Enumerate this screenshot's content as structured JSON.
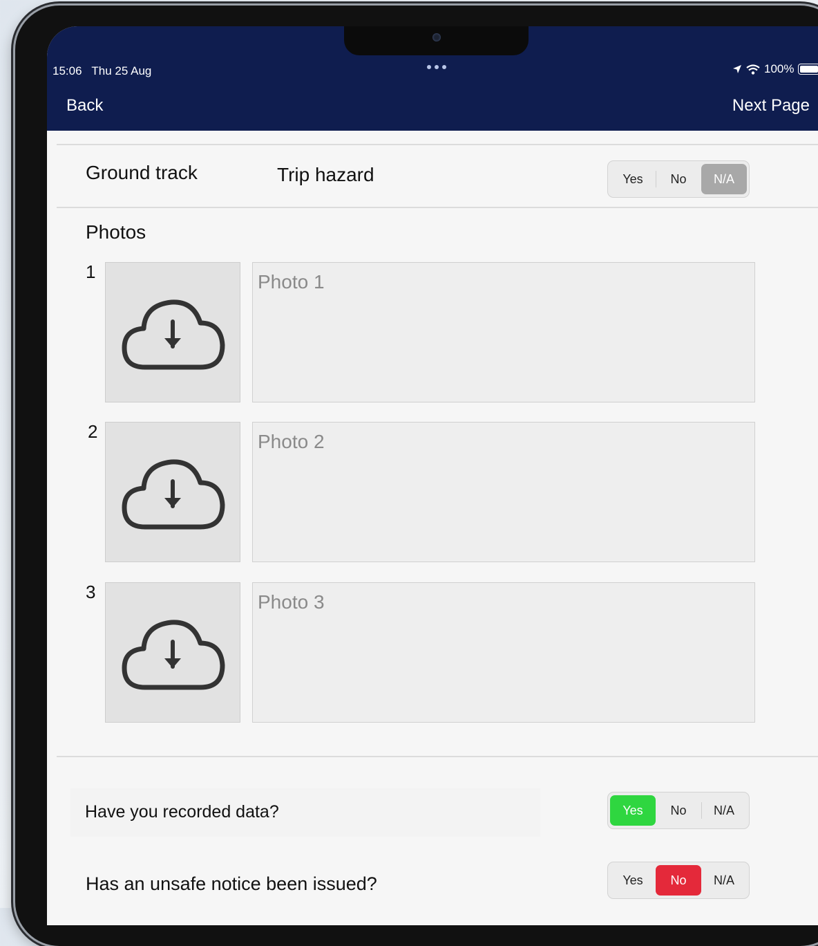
{
  "status": {
    "time_date": "15:06   Thu 25 Aug",
    "battery": "100%"
  },
  "nav": {
    "back": "Back",
    "next": "Next Page"
  },
  "ground_track": {
    "section_label": "Ground track",
    "item_label": "Trip hazard",
    "options": [
      "Yes",
      "No",
      "N/A"
    ],
    "selected": "N/A"
  },
  "photos": {
    "title": "Photos",
    "items": [
      {
        "number": "1",
        "placeholder": "Photo 1",
        "icon": "cloud-download-icon"
      },
      {
        "number": "2",
        "placeholder": "Photo 2",
        "icon": "cloud-download-icon"
      },
      {
        "number": "3",
        "placeholder": "Photo 3",
        "icon": "cloud-download-icon"
      }
    ]
  },
  "questions": [
    {
      "text": "Have you recorded data?",
      "options": [
        "Yes",
        "No",
        "N/A"
      ],
      "selected": "Yes"
    },
    {
      "text": "Has an unsafe notice been issued?",
      "options": [
        "Yes",
        "No",
        "N/A"
      ],
      "selected": "No"
    }
  ],
  "colors": {
    "header": "#0f1d4f",
    "selected_na": "#a8a8a8",
    "selected_yes": "#2fd640",
    "selected_no": "#e4293a"
  }
}
